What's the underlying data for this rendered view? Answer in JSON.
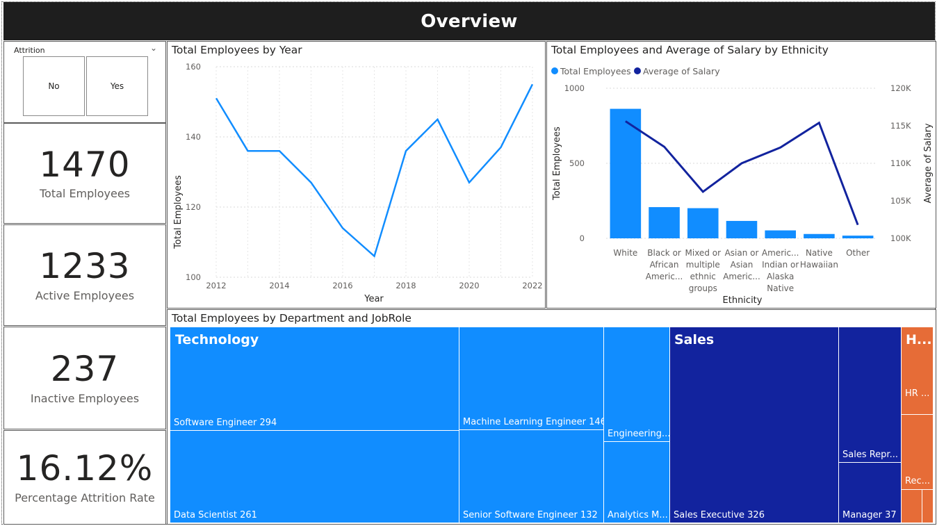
{
  "header": {
    "title": "Overview"
  },
  "slicer": {
    "title": "Attrition",
    "options": [
      "No",
      "Yes"
    ]
  },
  "cards": [
    {
      "value": "1470",
      "label": "Total Employees"
    },
    {
      "value": "1233",
      "label": "Active Employees"
    },
    {
      "value": "237",
      "label": "Inactive Employees"
    },
    {
      "value": "16.12%",
      "label": "Percentage Attrition Rate"
    }
  ],
  "chart_year": {
    "title": "Total Employees by Year",
    "xlabel": "Year",
    "ylabel": "Total Employees",
    "xticks": [
      "2012",
      "2014",
      "2016",
      "2018",
      "2020",
      "2022"
    ],
    "yticks": [
      "100",
      "120",
      "140",
      "160"
    ],
    "color": "#118DFF"
  },
  "chart_eth": {
    "title": "Total Employees and Average of Salary by Ethnicity",
    "legend": [
      "Total Employees",
      "Average of Salary"
    ],
    "xlabel": "Ethnicity",
    "ylabel_left": "Total Employees",
    "ylabel_right": "Average of Salary",
    "yticks_left": [
      "0",
      "500",
      "1000"
    ],
    "yticks_right": [
      "100K",
      "105K",
      "110K",
      "115K",
      "120K"
    ],
    "categories": [
      [
        "White"
      ],
      [
        "Black or",
        "African",
        "Americ..."
      ],
      [
        "Mixed or",
        "multiple",
        "ethnic",
        "groups"
      ],
      [
        "Asian or",
        "Asian",
        "Americ..."
      ],
      [
        "Americ...",
        "Indian or",
        "Alaska",
        "Native"
      ],
      [
        "Native",
        "Hawaiian"
      ],
      [
        "Other"
      ]
    ],
    "bar_color": "#118DFF",
    "line_color": "#12239E"
  },
  "chart_data": [
    {
      "type": "line",
      "title": "Total Employees by Year",
      "xlabel": "Year",
      "ylabel": "Total Employees",
      "x": [
        2012,
        2013,
        2014,
        2015,
        2016,
        2017,
        2018,
        2019,
        2020,
        2021,
        2022
      ],
      "values": [
        151,
        136,
        136,
        127,
        114,
        106,
        136,
        145,
        127,
        137,
        155
      ],
      "ylim": [
        100,
        160
      ],
      "xlim": [
        2012,
        2022
      ],
      "grid": true
    },
    {
      "type": "bar",
      "title": "Total Employees and Average of Salary by Ethnicity",
      "xlabel": "Ethnicity",
      "categories": [
        "White",
        "Black or African Americ...",
        "Mixed or multiple ethnic groups",
        "Asian or Asian Americ...",
        "Americ... Indian or Alaska Native",
        "Native Hawaiian",
        "Other"
      ],
      "series": [
        {
          "name": "Total Employees",
          "type": "bar",
          "axis": "left",
          "values": [
            863,
            208,
            201,
            116,
            53,
            29,
            18
          ]
        },
        {
          "name": "Average of Salary",
          "type": "line",
          "axis": "right",
          "values": [
            115600,
            112200,
            106200,
            110000,
            112100,
            115400,
            101800
          ]
        }
      ],
      "ylim_left": [
        0,
        1000
      ],
      "ylim_right": [
        100000,
        120000
      ],
      "legend": "top-left"
    },
    {
      "type": "treemap",
      "title": "Total Employees by Department and JobRole",
      "groups": [
        {
          "name": "Technology",
          "color": "#118DFF",
          "items": [
            {
              "label": "Software Engineer 294",
              "value": 294
            },
            {
              "label": "Data Scientist 261",
              "value": 261
            },
            {
              "label": "Machine Learning Engineer 146",
              "value": 146
            },
            {
              "label": "Senior Software Engineer 132",
              "value": 132
            },
            {
              "label": "Engineering...",
              "value": null
            },
            {
              "label": "Analytics M...",
              "value": null
            }
          ]
        },
        {
          "name": "Sales",
          "color": "#12239E",
          "items": [
            {
              "label": "Sales Executive 326",
              "value": 326
            },
            {
              "label": "Sales Repr...",
              "value": null
            },
            {
              "label": "Manager 37",
              "value": 37
            }
          ]
        },
        {
          "name": "H...",
          "color": "#E66C37",
          "items": [
            {
              "label": "HR ...",
              "value": null
            },
            {
              "label": "Rec...",
              "value": null
            }
          ]
        }
      ]
    }
  ],
  "treemap": {
    "title": "Total Employees by Department and JobRole",
    "tech": {
      "name": "Technology",
      "color": "#118DFF",
      "software_engineer": "Software Engineer 294",
      "data_scientist": "Data Scientist 261",
      "ml_engineer": "Machine Learning Engineer 146",
      "senior_se": "Senior Software Engineer 132",
      "engineering": "Engineering...",
      "analytics": "Analytics M..."
    },
    "sales": {
      "name": "Sales",
      "color": "#12239E",
      "sales_exec": "Sales Executive 326",
      "sales_rep": "Sales Repr...",
      "manager": "Manager 37"
    },
    "hr": {
      "name": "H...",
      "color": "#E66C37",
      "hr_role": "HR ...",
      "recruiter": "Rec..."
    }
  }
}
